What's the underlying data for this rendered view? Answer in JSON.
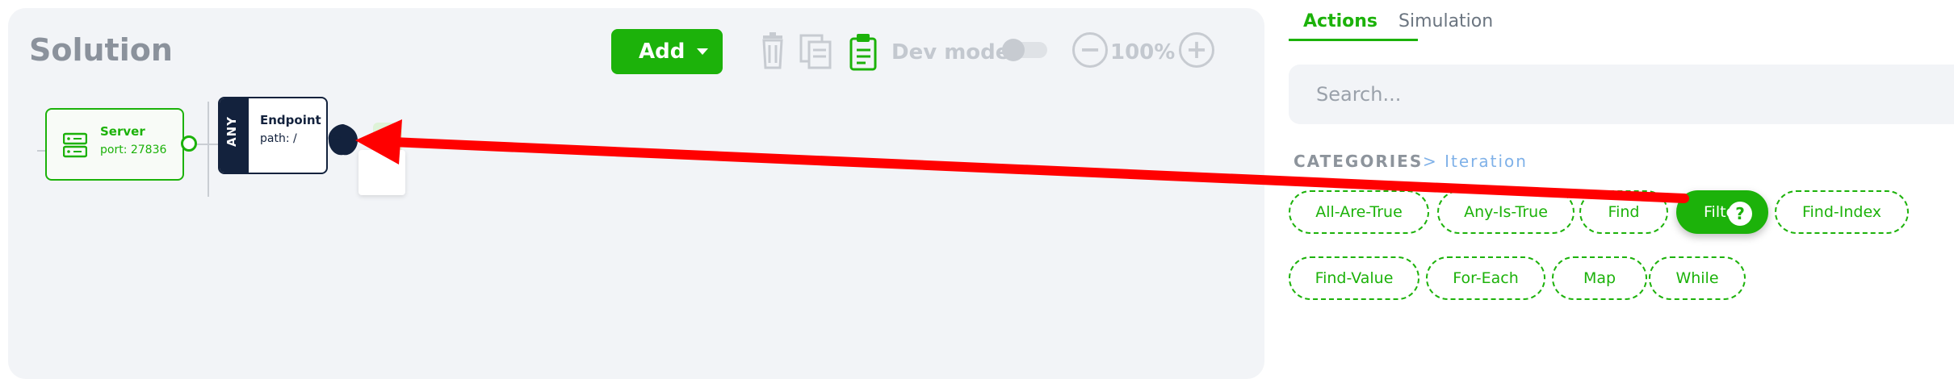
{
  "canvas": {
    "title": "Solution",
    "add_label": "Add",
    "dev_mode_label": "Dev mode",
    "zoom_minus": "−",
    "zoom_value": "100%",
    "zoom_plus": "+"
  },
  "nodes": {
    "server": {
      "label": "Server",
      "sub": "port: 27836"
    },
    "endpoint": {
      "method": "ANY",
      "label": "Endpoint",
      "sub": "path: /"
    }
  },
  "panel": {
    "tabs": [
      {
        "label": "Actions",
        "active": true
      },
      {
        "label": "Simulation",
        "active": false
      }
    ],
    "search_placeholder": "Search...",
    "categories_label": "CATEGORIES",
    "categories_crumb": "> Iteration",
    "chips": [
      {
        "label": "All-Are-True"
      },
      {
        "label": "Any-Is-True"
      },
      {
        "label": "Find"
      },
      {
        "label": "Filte",
        "active": true,
        "help": "?"
      },
      {
        "label": "Find-Index"
      },
      {
        "label": "Find-Value"
      },
      {
        "label": "For-Each"
      },
      {
        "label": "Map"
      },
      {
        "label": "While"
      }
    ]
  },
  "colors": {
    "accent": "#1cb20a",
    "node_dark": "#13223d",
    "arrow": "#ff0000"
  }
}
